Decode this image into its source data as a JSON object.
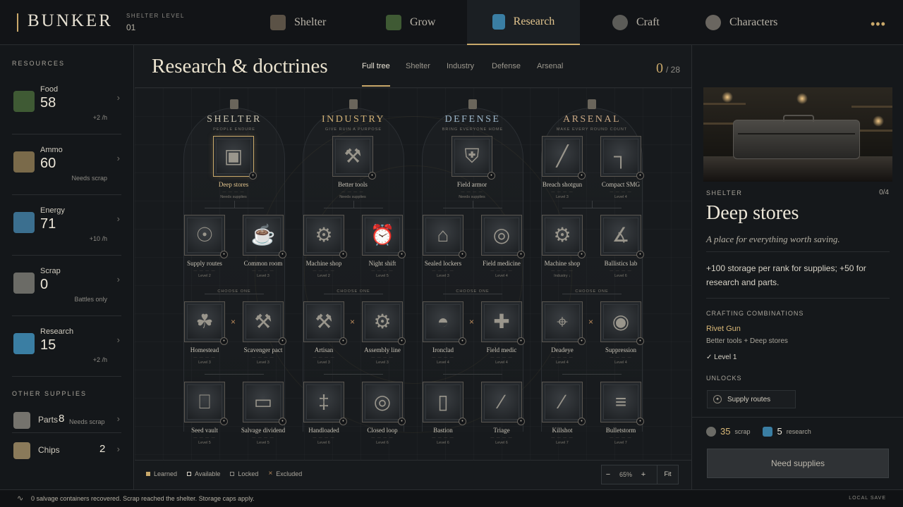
{
  "app": {
    "brand": "BUNKER",
    "shelter_level_label": "SHELTER LEVEL",
    "shelter_level_value": "01",
    "more": "•••"
  },
  "nav": [
    {
      "label": "Shelter",
      "icon": "shelter-icon"
    },
    {
      "label": "Grow",
      "icon": "grow-icon"
    },
    {
      "label": "Research",
      "icon": "research-icon",
      "active": true
    },
    {
      "label": "Craft",
      "icon": "craft-icon"
    },
    {
      "label": "Characters",
      "icon": "characters-icon"
    }
  ],
  "sidebar": {
    "resources_heading": "RESOURCES",
    "resources": [
      {
        "name": "Food",
        "value": "58",
        "sub": "+2 /h",
        "icon": "food-crate-icon",
        "color": "#3f5a34"
      },
      {
        "name": "Ammo",
        "value": "60",
        "sub": "Needs scrap",
        "icon": "ammo-icon",
        "color": "#7a6a4a"
      },
      {
        "name": "Energy",
        "value": "71",
        "sub": "+10 /h",
        "icon": "battery-icon",
        "color": "#3b6f8f"
      },
      {
        "name": "Scrap",
        "value": "0",
        "sub": "Battles only",
        "icon": "gear-scrap-icon",
        "color": "#6b6b66"
      },
      {
        "name": "Research",
        "value": "15",
        "sub": "+2 /h",
        "icon": "research-vial-icon",
        "color": "#3a7ea3"
      }
    ],
    "other_heading": "OTHER SUPPLIES",
    "other": [
      {
        "name": "Parts",
        "value": "8",
        "sub": "Needs scrap",
        "icon": "parts-icon",
        "color": "#75736d"
      },
      {
        "name": "Chips",
        "value": "2",
        "sub": "",
        "icon": "chips-icon",
        "color": "#8a7a5a"
      }
    ]
  },
  "main": {
    "title": "Research & doctrines",
    "subtabs": [
      "Full tree",
      "Shelter",
      "Industry",
      "Defense",
      "Arsenal"
    ],
    "progress_done": "0",
    "progress_total": "/ 28",
    "legend": [
      {
        "label": "Learned",
        "color": "#c9a86a"
      },
      {
        "label": "Available",
        "color": "#d9d4c8"
      },
      {
        "label": "Locked",
        "color": "#8c8a84"
      },
      {
        "label": "Excluded",
        "color": "#b8885a"
      }
    ],
    "zoom": {
      "minus": "−",
      "value": "65%",
      "plus": "+",
      "fit": "Fit"
    }
  },
  "tree": {
    "choose_one": "CHOOSE ONE",
    "dots": "— — — —",
    "branches": [
      {
        "title": "SHELTER",
        "subtitle": "PEOPLE ENDURE",
        "color": "#c9c2ae",
        "top": {
          "label": "Deep stores",
          "sub": "Needs supplies",
          "glyph": "▣",
          "available": true
        },
        "row2": [
          {
            "label": "Supply routes",
            "sub": "Level 2",
            "glyph": "☉"
          },
          {
            "label": "Common room",
            "sub": "Level 3",
            "glyph": "☕"
          }
        ],
        "row3": [
          {
            "label": "Homestead",
            "sub": "Level 3",
            "glyph": "☘"
          },
          {
            "label": "Scavenger pact",
            "sub": "Level 3",
            "glyph": "⚒"
          }
        ],
        "row4": [
          {
            "label": "Seed vault",
            "sub": "Level 5",
            "glyph": "⎕"
          },
          {
            "label": "Salvage dividend",
            "sub": "Level 5",
            "glyph": "▭"
          }
        ]
      },
      {
        "title": "INDUSTRY",
        "subtitle": "GIVE RUIN A PURPOSE",
        "color": "#d2b176",
        "top": {
          "label": "Better tools",
          "sub": "Needs supplies",
          "glyph": "⚒"
        },
        "row2": [
          {
            "label": "Machine shop",
            "sub": "Level 2",
            "glyph": "⚙"
          },
          {
            "label": "Night shift",
            "sub": "Level 5",
            "glyph": "⏰"
          }
        ],
        "row3": [
          {
            "label": "Artisan",
            "sub": "Level 3",
            "glyph": "⚒"
          },
          {
            "label": "Assembly line",
            "sub": "Level 3",
            "glyph": "⚙"
          }
        ],
        "row4": [
          {
            "label": "Handloaded",
            "sub": "Level 6",
            "glyph": "‡"
          },
          {
            "label": "Closed loop",
            "sub": "Level 6",
            "glyph": "◎"
          }
        ]
      },
      {
        "title": "DEFENSE",
        "subtitle": "BRING EVERYONE HOME",
        "color": "#9db6c9",
        "top": {
          "label": "Field armor",
          "sub": "Needs supplies",
          "glyph": "⛨"
        },
        "row2": [
          {
            "label": "Sealed lockers",
            "sub": "Level 3",
            "glyph": "⌂"
          },
          {
            "label": "Field medicine",
            "sub": "Level 4",
            "glyph": "◎"
          }
        ],
        "row3": [
          {
            "label": "Ironclad",
            "sub": "Level 4",
            "glyph": "◓"
          },
          {
            "label": "Field medic",
            "sub": "Level 4",
            "glyph": "✚"
          }
        ],
        "row4": [
          {
            "label": "Bastion",
            "sub": "Level 6",
            "glyph": "▯"
          },
          {
            "label": "Triage",
            "sub": "Level 6",
            "glyph": "∕"
          }
        ]
      },
      {
        "title": "ARSENAL",
        "subtitle": "MAKE EVERY ROUND COUNT",
        "color": "#caa884",
        "row1": [
          {
            "label": "Breach shotgun",
            "sub": "Level 3",
            "glyph": "╱"
          },
          {
            "label": "Compact SMG",
            "sub": "Level 4",
            "glyph": "┐"
          }
        ],
        "row2": [
          {
            "label": "Machine shop",
            "sub": "Industry ↓",
            "glyph": "⚙"
          },
          {
            "label": "Ballistics lab",
            "sub": "Level 6",
            "glyph": "∡"
          }
        ],
        "row3": [
          {
            "label": "Deadeye",
            "sub": "Level 4",
            "glyph": "⌖"
          },
          {
            "label": "Suppression",
            "sub": "Level 4",
            "glyph": "◉"
          }
        ],
        "row4": [
          {
            "label": "Killshot",
            "sub": "Level 7",
            "glyph": "∕"
          },
          {
            "label": "Bulletstorm",
            "sub": "Level 7",
            "glyph": "≡"
          }
        ]
      }
    ]
  },
  "detail": {
    "category": "SHELTER",
    "rank": "0/4",
    "title": "Deep stores",
    "tagline": "A place for everything worth saving.",
    "description": "+100 storage per rank for supplies; +50 for research and parts.",
    "crafting_heading": "CRAFTING COMBINATIONS",
    "craft_name": "Rivet Gun",
    "craft_recipe": "Better tools + Deep stores",
    "craft_level": "✓ Level 1",
    "unlocks_heading": "UNLOCKS",
    "unlock": "Supply routes",
    "cost_scrap_value": "35",
    "cost_scrap_unit": "scrap",
    "cost_research_value": "5",
    "cost_research_unit": "research",
    "button": "Need supplies"
  },
  "status": {
    "text": "0 salvage containers recovered. Scrap reached the shelter. Storage caps apply.",
    "save": "LOCAL SAVE"
  }
}
